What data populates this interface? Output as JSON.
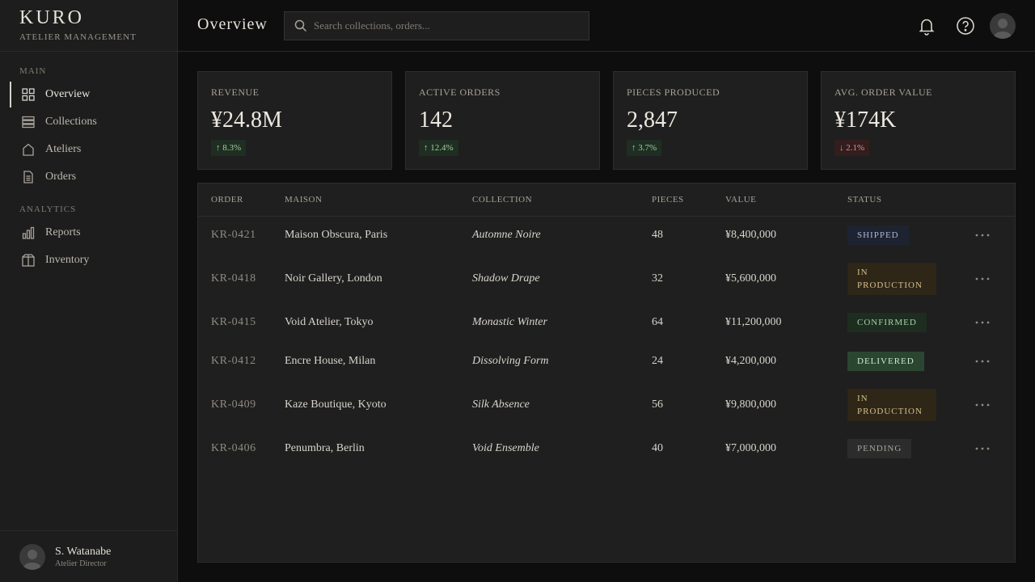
{
  "brand": {
    "name": "KURO",
    "subtitle": "ATELIER MANAGEMENT"
  },
  "sidebar": {
    "sections": [
      {
        "label": "MAIN"
      },
      {
        "label": "ANALYTICS"
      }
    ],
    "items": [
      {
        "label": "Overview",
        "icon": "grid-icon",
        "active": true
      },
      {
        "label": "Collections",
        "icon": "layers-icon"
      },
      {
        "label": "Ateliers",
        "icon": "house-icon"
      },
      {
        "label": "Orders",
        "icon": "document-icon"
      },
      {
        "label": "Reports",
        "icon": "bar-chart-icon"
      },
      {
        "label": "Inventory",
        "icon": "box-icon"
      }
    ],
    "user": {
      "name": "S. Watanabe",
      "role": "Atelier Director"
    }
  },
  "header": {
    "title": "Overview",
    "search_placeholder": "Search collections, orders..."
  },
  "kpis": [
    {
      "label": "REVENUE",
      "value": "¥24.8M",
      "delta": "↑ 8.3%",
      "trend": "up"
    },
    {
      "label": "ACTIVE ORDERS",
      "value": "142",
      "delta": "↑ 12.4%",
      "trend": "up"
    },
    {
      "label": "PIECES PRODUCED",
      "value": "2,847",
      "delta": "↑ 3.7%",
      "trend": "up"
    },
    {
      "label": "AVG. ORDER VALUE",
      "value": "¥174K",
      "delta": "↓ 2.1%",
      "trend": "down"
    }
  ],
  "table": {
    "columns": [
      "ORDER",
      "MAISON",
      "COLLECTION",
      "PIECES",
      "VALUE",
      "STATUS"
    ],
    "rows": [
      {
        "order": "KR-0421",
        "maison": "Maison Obscura, Paris",
        "collection": "Automne Noire",
        "pieces": "48",
        "value": "¥8,400,000",
        "status": "SHIPPED"
      },
      {
        "order": "KR-0418",
        "maison": "Noir Gallery, London",
        "collection": "Shadow Drape",
        "pieces": "32",
        "value": "¥5,600,000",
        "status": "IN PRODUCTION"
      },
      {
        "order": "KR-0415",
        "maison": "Void Atelier, Tokyo",
        "collection": "Monastic Winter",
        "pieces": "64",
        "value": "¥11,200,000",
        "status": "CONFIRMED"
      },
      {
        "order": "KR-0412",
        "maison": "Encre House, Milan",
        "collection": "Dissolving Form",
        "pieces": "24",
        "value": "¥4,200,000",
        "status": "DELIVERED"
      },
      {
        "order": "KR-0409",
        "maison": "Kaze Boutique, Kyoto",
        "collection": "Silk Absence",
        "pieces": "56",
        "value": "¥9,800,000",
        "status": "IN PRODUCTION"
      },
      {
        "order": "KR-0406",
        "maison": "Penumbra, Berlin",
        "collection": "Void Ensemble",
        "pieces": "40",
        "value": "¥7,000,000",
        "status": "PENDING"
      }
    ]
  }
}
